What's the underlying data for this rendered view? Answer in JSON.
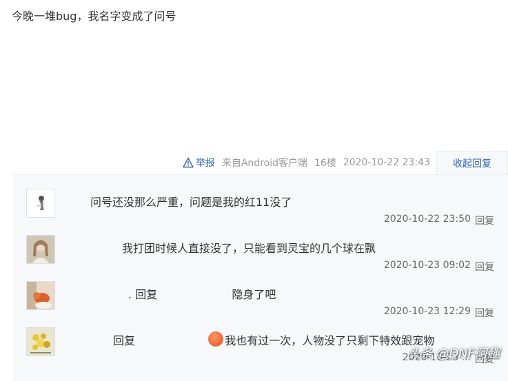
{
  "post": {
    "text": "今晚一堆bug，我名字变成了问号"
  },
  "meta": {
    "report": "举报",
    "source": "来自Android客户端",
    "floor": "16楼",
    "time": "2020-10-22 23:43",
    "collapse": "收起回复"
  },
  "replies": [
    {
      "content": "问号还没那么严重，问题是我的红11没了",
      "time": "2020-10-22 23:50",
      "reply": "回复"
    },
    {
      "content": "我打团时候人直接没了，只能看到灵宝的几个球在飘",
      "time": "2020-10-23 09:02",
      "reply": "回复"
    },
    {
      "prefix_dot": ".",
      "prefix_reply": "回复",
      "content": "隐身了吧",
      "time": "2020-10-23 12:29",
      "reply": "回复"
    },
    {
      "prefix_reply": "回复",
      "content": "我也有过一次，人物没了只剩下特效跟宠物",
      "time": "2020-10-23 ...",
      "reply": "回复"
    }
  ],
  "watermark": "头条 @DNF阿趣",
  "colors": {
    "link": "#2d64b3",
    "reply_bg": "#f7f8fa",
    "muted": "#999999"
  }
}
